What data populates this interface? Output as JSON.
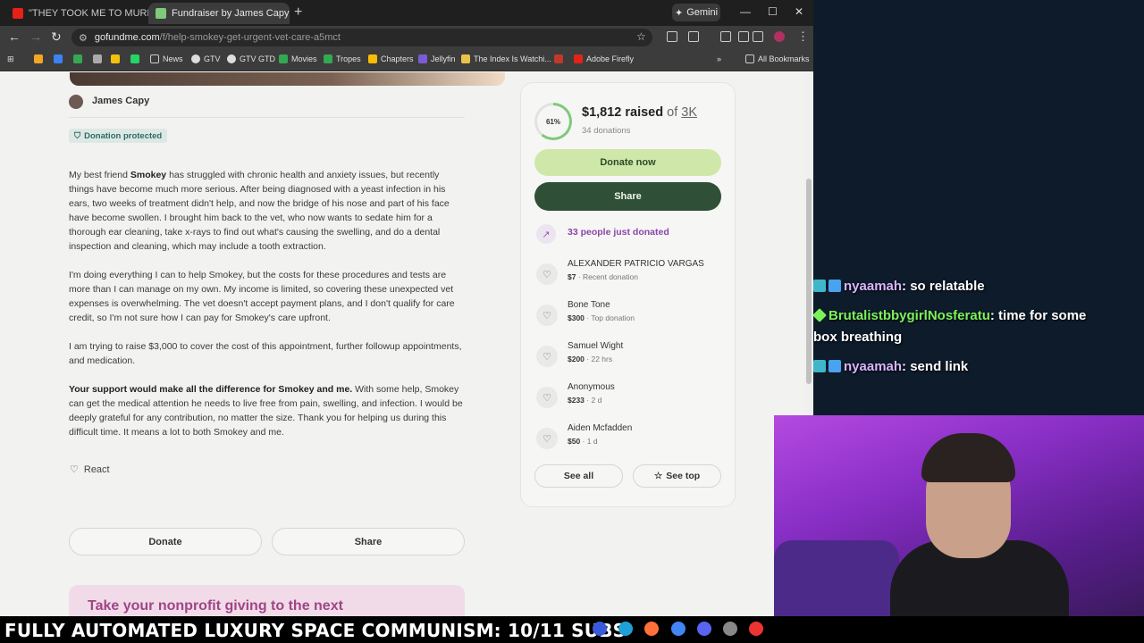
{
  "browser": {
    "tabs": [
      {
        "title": "\"THEY TOOK ME TO MURDER P",
        "active": false
      },
      {
        "title": "Fundraiser by James Capy : Sup",
        "active": true
      }
    ],
    "gemini_label": "Gemini",
    "url_host": "gofundme.com",
    "url_path": "/f/help-smokey-get-urgent-vet-care-a5mct",
    "bookmarks": [
      "News",
      "GTV",
      "GTV GTD",
      "Movies",
      "Tropes",
      "Chapters",
      "Jellyfin",
      "The Index Is Watchi...",
      "Adobe Firefly"
    ],
    "all_bookmarks": "All Bookmarks"
  },
  "fundraiser": {
    "organizer": "James Capy",
    "protected_badge": "Donation protected",
    "story": {
      "p1_a": "My best friend ",
      "p1_b": "Smokey",
      "p1_c": " has struggled with chronic health and anxiety issues, but recently things have become much more serious. After being diagnosed with a yeast infection in his ears, two weeks of treatment didn't help, and now the bridge of his nose and part of his face have become swollen. I brought him back to the vet, who now wants to sedate him for a thorough ear cleaning, take x-rays to find out what's causing the swelling, and do a dental inspection and cleaning, which may include a tooth extraction.",
      "p2": "I'm doing everything I can to help Smokey, but the costs for these procedures and tests are more than I can manage on my own. My income is limited, so covering these unexpected vet expenses is overwhelming. The vet doesn't accept payment plans, and I don't qualify for care credit, so I'm not sure how I can pay for Smokey's care upfront.",
      "p3": "I am trying to raise $3,000 to cover the cost of this appointment, further followup appointments, and medication.",
      "p4_a": "Your support would make all the difference for Smokey and me.",
      "p4_b": " With some help, Smokey can get the medical attention he needs to live free from pain, swelling, and infection. I would be deeply grateful for any contribution, no matter the size. Thank you for helping us during this difficult time. It means a lot to both Smokey and me."
    },
    "react_label": "React",
    "donate_label": "Donate",
    "share_label": "Share",
    "promo_text": "Take your nonprofit giving to the next"
  },
  "sidebar_card": {
    "progress_pct_label": "61%",
    "progress_fraction": 0.61,
    "raised": "$1,812 raised",
    "of_label": " of ",
    "goal": "3K",
    "donation_count": "34 donations",
    "donate_now": "Donate now",
    "share": "Share",
    "recent_activity": "33 people just donated",
    "donors": [
      {
        "name": "ALEXANDER PATRICIO VARGAS",
        "amount": "$7",
        "detail": " · Recent donation"
      },
      {
        "name": "Bone Tone",
        "amount": "$300",
        "detail": " · Top donation"
      },
      {
        "name": "Samuel Wight",
        "amount": "$200",
        "detail": " · 22 hrs"
      },
      {
        "name": "Anonymous",
        "amount": "$233",
        "detail": " · 2 d"
      },
      {
        "name": "Aiden Mcfadden",
        "amount": "$50",
        "detail": " · 1 d"
      }
    ],
    "see_all": "See all",
    "see_top": "See top"
  },
  "chat": [
    {
      "user": "nyaamah",
      "sep": ": ",
      "text": "so relatable",
      "color": "#d8b4ff"
    },
    {
      "user": "BrutalistbbygirlNosferatu",
      "sep": ": ",
      "text": "time for some box breathing",
      "color": "#7cf25a"
    },
    {
      "user": "nyaamah",
      "sep": ": ",
      "text": "send link",
      "color": "#d8b4ff"
    }
  ],
  "ticker": "FULLY AUTOMATED LUXURY SPACE COMMUNISM: 10/11 SUBS"
}
